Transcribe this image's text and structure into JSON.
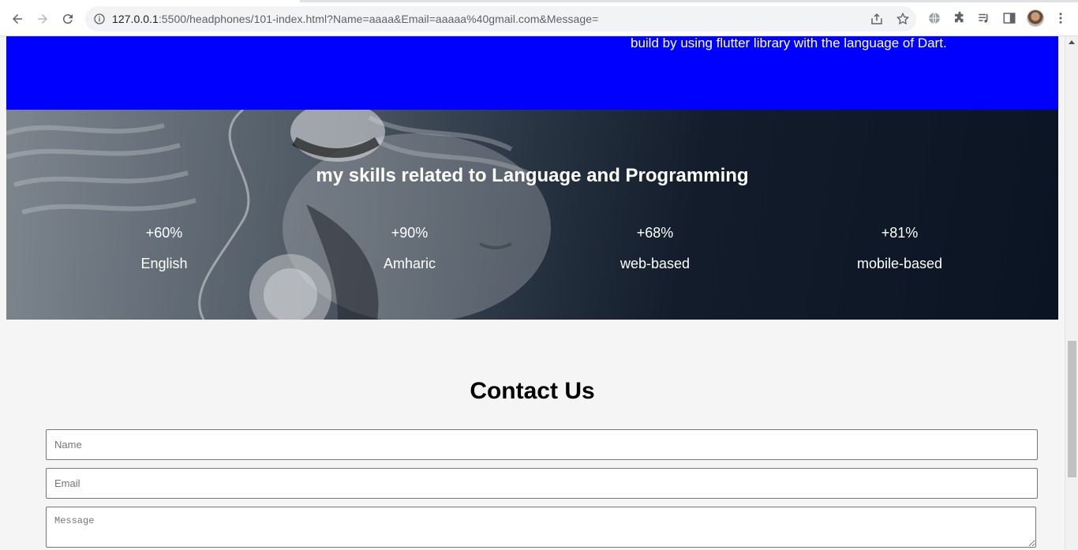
{
  "browser": {
    "url_host": "127.0.0.1",
    "url_rest": ":5500/headphones/101-index.html?Name=aaaa&Email=aaaaa%40gmail.com&Message=",
    "icons": [
      "back-arrow-icon",
      "forward-arrow-icon",
      "reload-icon",
      "info-icon",
      "share-icon",
      "star-icon",
      "globe-icon",
      "puzzle-icon",
      "media-queue-icon",
      "side-panel-icon",
      "avatar",
      "more-vert-icon"
    ]
  },
  "blue_band": {
    "right_text": "build by using flutter library with the language of Dart.",
    "left_text": "",
    "background": "#0000ff"
  },
  "skills": {
    "title": "my skills related to Language and Programming",
    "items": [
      {
        "percent": "+60%",
        "label": "English"
      },
      {
        "percent": "+90%",
        "label": "Amharic"
      },
      {
        "percent": "+68%",
        "label": "web-based"
      },
      {
        "percent": "+81%",
        "label": "mobile-based"
      }
    ]
  },
  "contact": {
    "title": "Contact Us",
    "name_placeholder": "Name",
    "email_placeholder": "Email",
    "message_placeholder": "Message"
  }
}
